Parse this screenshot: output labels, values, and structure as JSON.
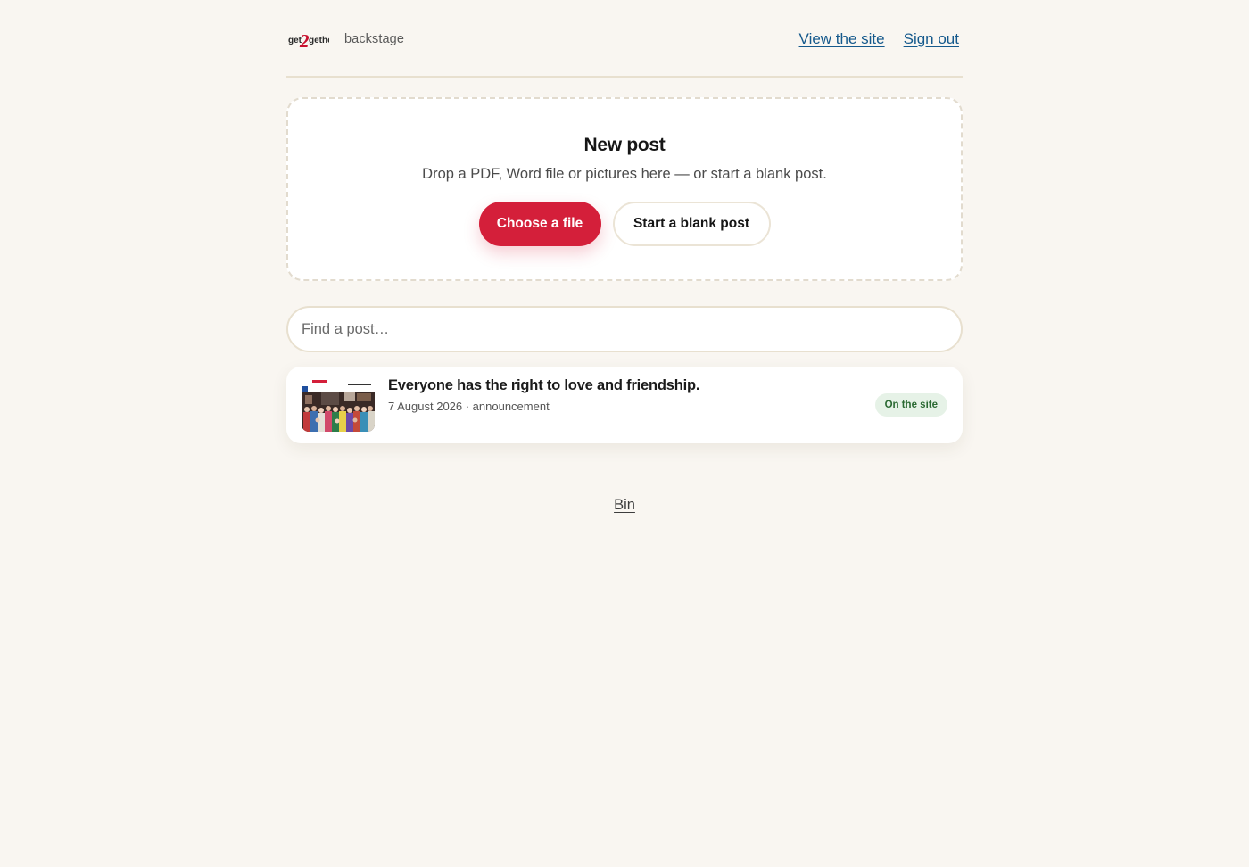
{
  "header": {
    "logo_text": "get2gether",
    "section_label": "backstage",
    "links": {
      "view_site": "View the site",
      "sign_out": "Sign out"
    }
  },
  "new_post": {
    "title": "New post",
    "subtitle": "Drop a PDF, Word file or pictures here — or start a blank post.",
    "choose_file_label": "Choose a file",
    "blank_post_label": "Start a blank post"
  },
  "search": {
    "placeholder": "Find a post…",
    "value": ""
  },
  "posts": [
    {
      "title": "Everyone has the right to love and friendship.",
      "meta": "7 August 2026 · announcement",
      "status": "On the site",
      "thumbnail_icon": "group-photo"
    }
  ],
  "footer": {
    "bin_label": "Bin"
  },
  "colors": {
    "accent": "#d41f3a",
    "link": "#15598c",
    "background": "#f9f6f1",
    "status_bg": "#e6f2e7",
    "status_text": "#2b6a33"
  }
}
